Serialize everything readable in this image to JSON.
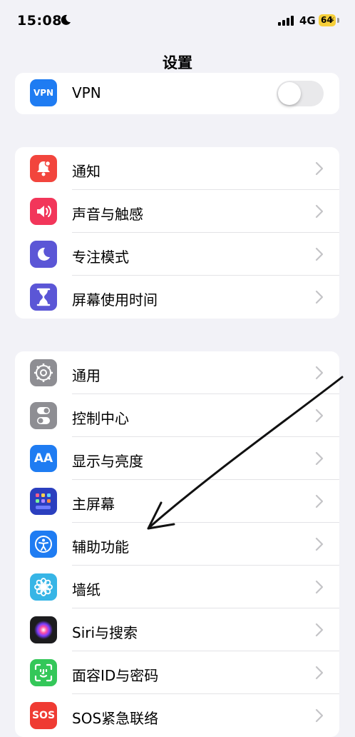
{
  "status_bar": {
    "time": "15:08",
    "network": "4G",
    "battery": "64"
  },
  "header": {
    "title": "设置"
  },
  "vpn": {
    "icon_text": "VPN",
    "label": "VPN",
    "toggle_on": false
  },
  "group1": [
    {
      "label": "通知",
      "icon": "bell-icon",
      "color": "#f2453d"
    },
    {
      "label": "声音与触感",
      "icon": "speaker-icon",
      "color": "#f2365a"
    },
    {
      "label": "专注模式",
      "icon": "moon-icon",
      "color": "#5b56d6"
    },
    {
      "label": "屏幕使用时间",
      "icon": "hourglass-icon",
      "color": "#5b56d6"
    }
  ],
  "group2": [
    {
      "label": "通用",
      "icon": "gear-icon",
      "color": "#8e8e93"
    },
    {
      "label": "控制中心",
      "icon": "switches-icon",
      "color": "#8e8e93"
    },
    {
      "label": "显示与亮度",
      "icon": "text-size-icon",
      "icon_text": "AA",
      "color": "#1f7cf2"
    },
    {
      "label": "主屏幕",
      "icon": "home-grid-icon",
      "color": "#2b3fbf"
    },
    {
      "label": "辅助功能",
      "icon": "accessibility-icon",
      "color": "#1f7cf2"
    },
    {
      "label": "墙纸",
      "icon": "flower-icon",
      "color": "#37b5e6"
    },
    {
      "label": "Siri与搜索",
      "icon": "siri-icon",
      "color": "#1c1c1e"
    },
    {
      "label": "面容ID与密码",
      "icon": "face-id-icon",
      "color": "#34c759"
    },
    {
      "label": "SOS紧急联络",
      "icon": "sos-icon",
      "icon_text": "SOS",
      "color": "#ef3b33"
    }
  ]
}
